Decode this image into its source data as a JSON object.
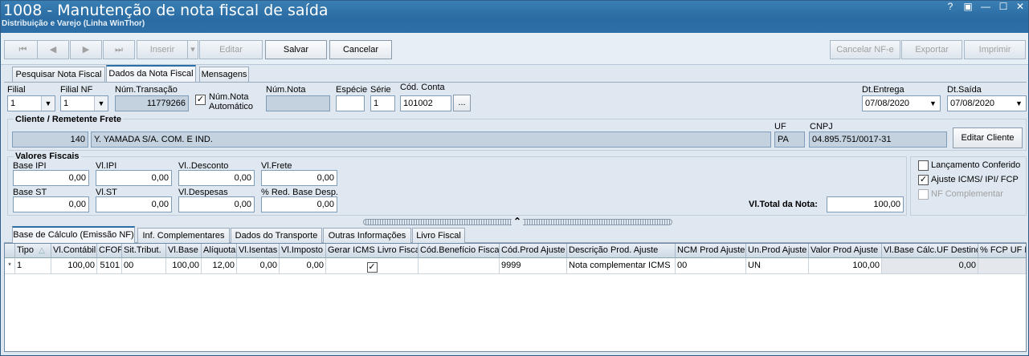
{
  "window": {
    "title": "1008 - Manutenção de nota fiscal de saída",
    "subtitle": "Distribuição e Varejo (Linha WinThor)",
    "controls": [
      "?",
      "▣",
      "—",
      "☐",
      "✕"
    ]
  },
  "toolbar": {
    "first": "⏮",
    "prev": "◀",
    "next": "▶",
    "last": "⏭",
    "inserir": "Inserir",
    "inserir_arrow": "▾",
    "editar": "Editar",
    "salvar": "Salvar",
    "cancelar": "Cancelar",
    "cancelar_nfe": "Cancelar NF-e",
    "exportar": "Exportar",
    "imprimir": "Imprimir"
  },
  "top_tabs": [
    "Pesquisar Nota Fiscal",
    "Dados da Nota Fiscal",
    "Mensagens"
  ],
  "header": {
    "filial_label": "Filial",
    "filial_value": "1",
    "filial_nf_label": "Filial NF",
    "filial_nf_value": "1",
    "num_transacao_label": "Núm.Transação",
    "num_transacao_value": "11779266",
    "num_nota_auto_label": "Núm.Nota Automático",
    "num_nota_auto_checked": "✓",
    "num_nota_label": "Núm.Nota",
    "num_nota_value": "",
    "especie_label": "Espécie",
    "especie_value": "",
    "serie_label": "Série",
    "serie_value": "1",
    "cod_conta_label": "Cód. Conta",
    "cod_conta_value": "101002",
    "cod_conta_btn": "...",
    "dt_entrega_label": "Dt.Entrega",
    "dt_entrega_value": "07/08/2020",
    "dt_saida_label": "Dt.Saída",
    "dt_saida_value": "07/08/2020"
  },
  "cliente": {
    "section_title": "Cliente / Remetente Frete",
    "codigo": "140",
    "nome": "Y. YAMADA S/A. COM. E IND.",
    "uf_label": "UF",
    "uf_value": "PA",
    "cnpj_label": "CNPJ",
    "cnpj_value": "04.895.751/0017-31",
    "editar_btn": "Editar Cliente"
  },
  "valores": {
    "section_title": "Valores Fiscais",
    "base_ipi_label": "Base IPI",
    "base_ipi_value": "0,00",
    "vl_ipi_label": "Vl.IPI",
    "vl_ipi_value": "0,00",
    "vl_desconto_label": "Vl..Desconto",
    "vl_desconto_value": "0,00",
    "vl_frete_label": "Vl.Frete",
    "vl_frete_value": "0,00",
    "base_st_label": "Base ST",
    "base_st_value": "0,00",
    "vl_st_label": "Vl.ST",
    "vl_st_value": "0,00",
    "vl_despesas_label": "Vl.Despesas",
    "vl_despesas_value": "0,00",
    "red_base_label": "% Red. Base Desp.",
    "red_base_value": "0,00",
    "vl_total_label": "Vl.Total da Nota:",
    "vl_total_value": "100,00",
    "lancamento_label": "Lançamento Conferido",
    "lancamento_checked": "",
    "ajuste_label": "Ajuste ICMS/ IPI/ FCP",
    "ajuste_checked": "✓",
    "nf_complementar_label": "NF Complementar",
    "nf_complementar_checked": ""
  },
  "splitter_icon": "⌃",
  "bottom_tabs": [
    "Base de Cálculo (Emissão NF)",
    "Inf. Complementares",
    "Dados do Transporte",
    "Outras Informações",
    "Livro Fiscal"
  ],
  "grid": {
    "sort_indicator": "△",
    "columns": [
      "",
      "Tipo",
      "Vl.Contábil",
      "CFOP",
      "Sit.Tribut.",
      "Vl.Base",
      "Alíquota",
      "Vl.Isentas",
      "Vl.Imposto",
      "Gerar ICMS Livro Fiscal",
      "Cód.Benefício Fiscal",
      "Cód.Prod Ajuste",
      "Descrição Prod. Ajuste",
      "NCM Prod Ajuste",
      "Un.Prod Ajuste",
      "Valor Prod Ajuste",
      "Vl.Base Cálc.UF Destino",
      "% FCP UF D"
    ],
    "rows": [
      [
        "*",
        "1",
        "100,00",
        "5101",
        "00",
        "100,00",
        "12,00",
        "0,00",
        "0,00",
        "✓",
        "",
        "9999",
        "Nota complementar ICMS",
        "00",
        "UN",
        "100,00",
        "0,00",
        ""
      ]
    ]
  }
}
